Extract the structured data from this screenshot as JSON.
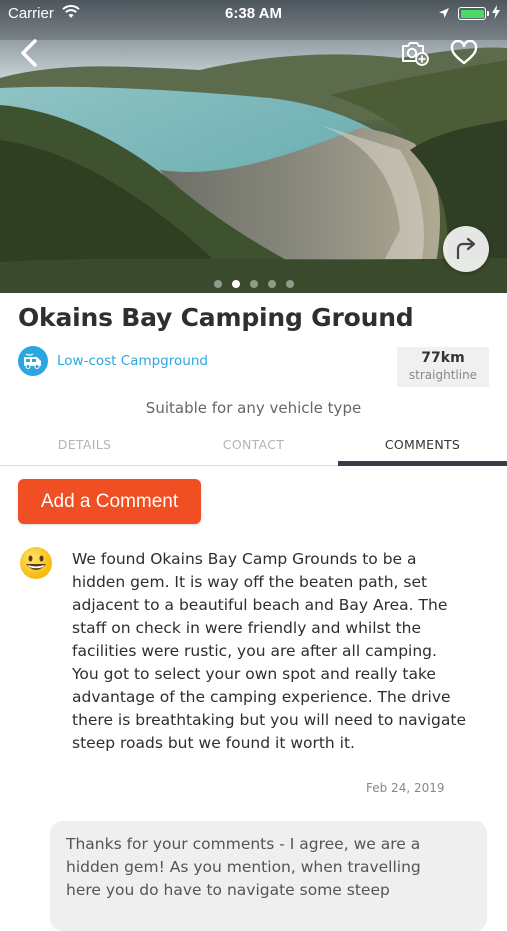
{
  "status_bar": {
    "carrier": "Carrier",
    "time": "6:38 AM",
    "battery_color": "#4cd964"
  },
  "hero": {
    "icons": [
      "back-arrow-icon",
      "camera-add-icon",
      "heart-icon",
      "share-arrow-icon"
    ],
    "carousel": {
      "total": 5,
      "active_index": 1
    }
  },
  "campground": {
    "title": "Okains Bay Camping Ground",
    "type_label": "Low-cost Campground",
    "type_icon": "campervan-icon",
    "type_color": "#2aa7e0",
    "distance": "77km",
    "distance_sub": "straightline",
    "suitability": "Suitable for any vehicle type"
  },
  "tabs": [
    {
      "label": "DETAILS",
      "active": false
    },
    {
      "label": "CONTACT",
      "active": false
    },
    {
      "label": "COMMENTS",
      "active": true
    }
  ],
  "comments_section": {
    "add_button_label": "Add a Comment",
    "add_button_color": "#f04e23",
    "comment": {
      "emoji": "grinning-face-icon",
      "text": "We found Okains Bay Camp Grounds to be a hidden gem. It is way off the beaten path, set adjacent to a beautiful beach and Bay Area.  The staff on check in were friendly and whilst the facilities were rustic, you are after all camping.  You got to select your own spot and really take advantage of the camping experience.  The drive there is breathtaking but you will need to navigate steep roads but we found it worth it.",
      "date": "Feb 24, 2019"
    },
    "reply": {
      "text": "Thanks for your comments - I agree, we are a hidden gem!  As you mention, when travelling here you do have to navigate some steep"
    }
  }
}
